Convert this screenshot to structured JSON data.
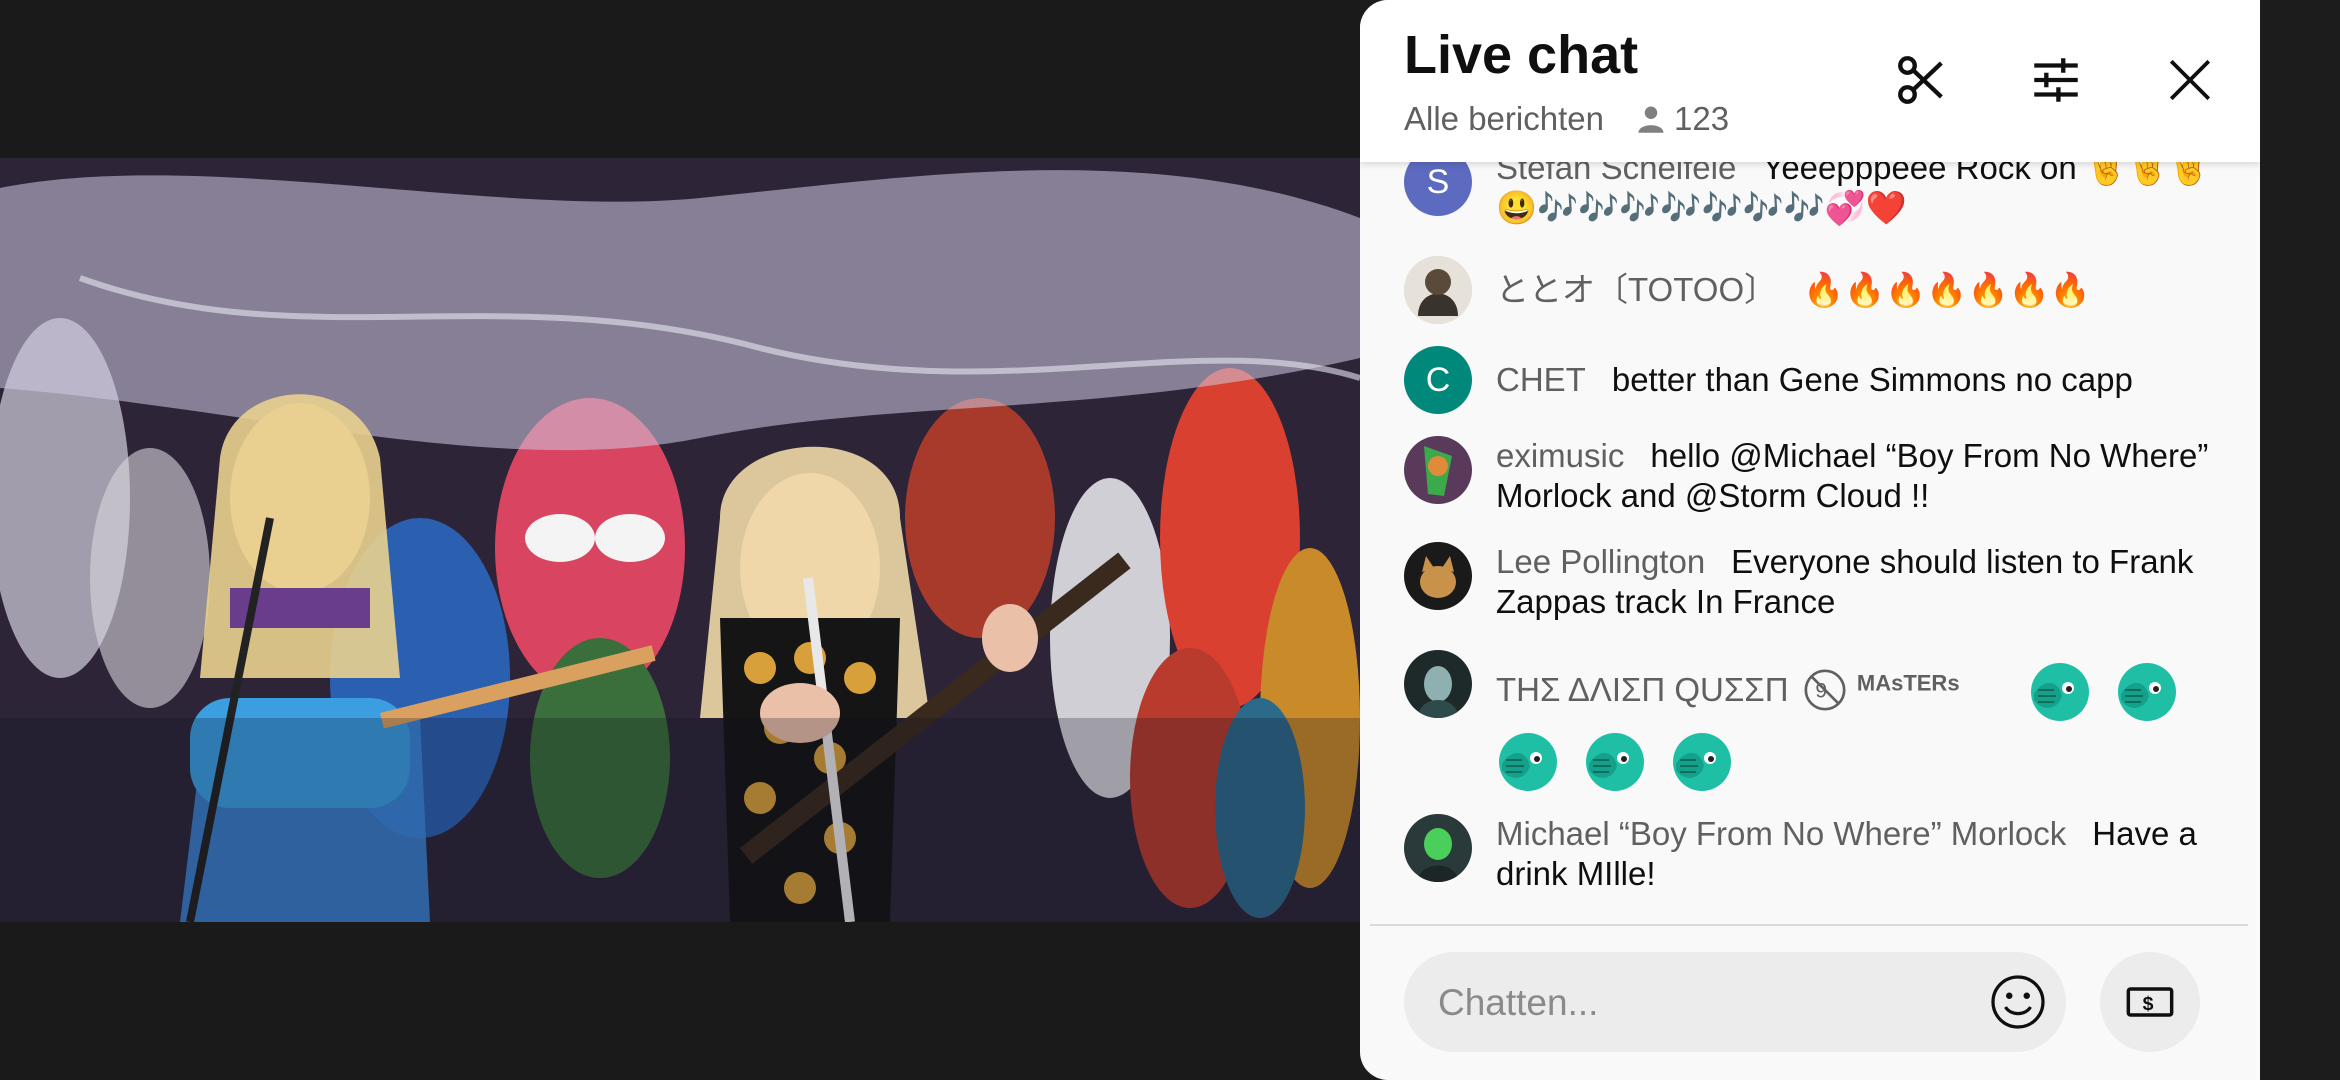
{
  "chat": {
    "title": "Live chat",
    "mode": "Alle berichten",
    "viewer_count": "123",
    "input_placeholder": "Chatten...",
    "messages": [
      {
        "author": "Stefan Scheifele",
        "avatar_letter": "S",
        "avatar_color": "#5c6bc0",
        "text": "Yeeepppeee Rock on 🤘🤘🤘😃🎶🎶🎶🎶🎶🎶🎶💞❤️"
      },
      {
        "author": "ととオ〔TOTOO〕",
        "text": "🔥🔥🔥🔥🔥🔥🔥"
      },
      {
        "author": "CHET",
        "avatar_letter": "C",
        "avatar_color": "#00897b",
        "text": "better than Gene Simmons no capp"
      },
      {
        "author": "eximusic",
        "text": "hello @Michael “Boy From No Where” Morlock and @Storm Cloud !!"
      },
      {
        "author": "Lee Pollington",
        "text": "Everyone should listen to Frank Zappas track In France"
      },
      {
        "author": "ΤΗΣ ΔΛΙΣΠ QUΣΣΠ",
        "badge": "MAsTERs"
      },
      {
        "author": "Michael “Boy From No Where” Morlock",
        "text": "Have a drink MIlle!"
      }
    ]
  },
  "icons": {
    "clip": "scissors-icon",
    "filter": "tune-icon",
    "close": "close-icon",
    "viewers": "person-icon",
    "emoji": "smiley-icon",
    "super_chat": "dollar-bill-icon"
  },
  "colors": {
    "panel_bg": "#f9f9f9",
    "header_bg": "#ffffff",
    "title": "#0f0f0f",
    "secondary_text": "#606060",
    "input_bg": "#ececec",
    "emote_teal": "#1fbfa5"
  }
}
